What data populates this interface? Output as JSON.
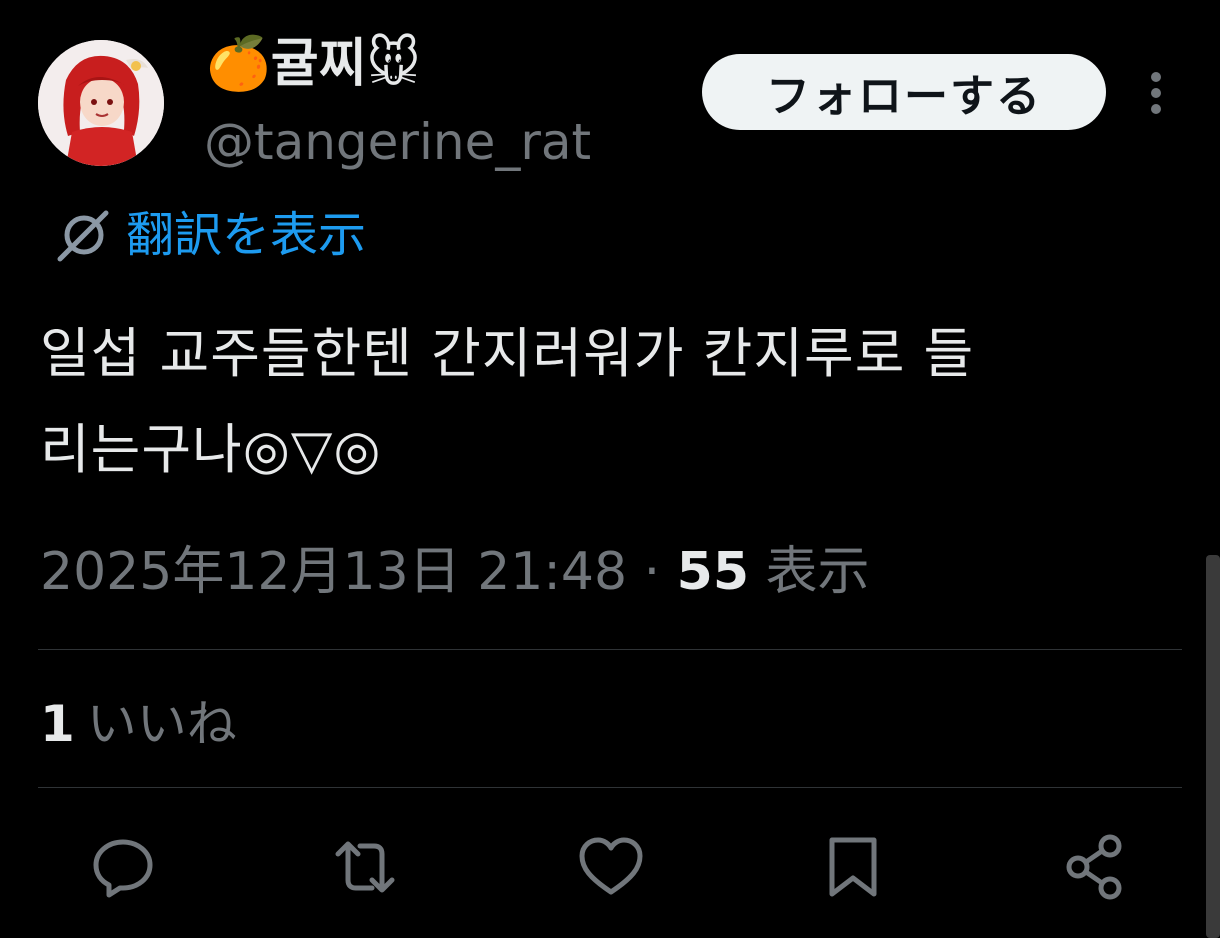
{
  "tweet": {
    "author": {
      "display_name": "🍊귤찌🐭",
      "handle": "@tangerine_rat"
    },
    "follow_label": "フォローする",
    "translate_label": "翻訳を表示",
    "text_lines": [
      "일섭 교주들한텐 간지러워가 칸지루로 들",
      "리는구나◎▽◎"
    ],
    "timestamp": "2025年12月13日 21:48",
    "separator": " · ",
    "views_count": "55",
    "views_label": " 表示",
    "likes_count": "1",
    "likes_label": "いいね"
  },
  "icons": {
    "more": "more-vertical-icon",
    "translate": "translate-globe-icon",
    "reply": "reply-icon",
    "retweet": "retweet-icon",
    "like": "heart-icon",
    "bookmark": "bookmark-icon",
    "share": "share-icon"
  },
  "colors": {
    "background": "#000000",
    "text_primary": "#e7e9ea",
    "text_secondary": "#71767b",
    "accent_link": "#1d9bf0",
    "follow_button_bg": "#eff3f4",
    "divider": "#2f3336"
  }
}
